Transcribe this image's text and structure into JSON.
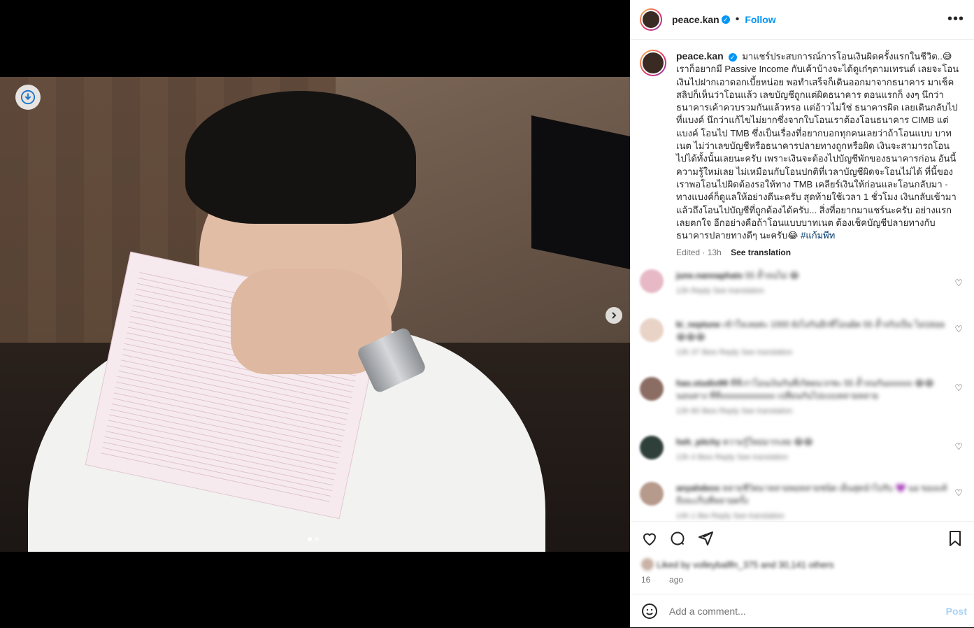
{
  "post": {
    "username": "peace.kan",
    "follow_label": "Follow",
    "more_label": "•••",
    "caption": "มาแชร์ประสบการณ์การโอนเงินผิดครั้งแรกในชีวิต..😅 เราก็อยากมี Passive Income กับเค้าบ้างจะได้ดูเก๋ๆตามเทรนด์ เลยจะโอนเงินไปฝากเอาดอกเบี้ยหน่อย พอทำเสร็จก็เดินออกมาจากธนาคาร มาเช็คสลิปก็เห็นว่าโอนแล้ว เลขบัญชีถูกแต่ผิดธนาคาร ตอนแรกก็ งงๆ นึกว่าธนาคารเค้าควบรวมกันแล้วหรอ แต่อ้าวไม่ใช่ ธนาคารผิด เลยเดินกลับไปที่แบงค์ นึกว่าแก้ไขไม่ยากซึ่งจากใบโอนเราต้องโอนธนาคาร CIMB แต่แบงค์ โอนไป TMB ซึ่งเป็นเรื่องที่อยากบอกทุกคนเลยว่าถ้าโอนแบบ บาทเนต ไม่ว่าเลขบัญชีหรือธนาคารปลายทางถูกหรือผิด เงินจะสามารถโอนไปได้ทั้งนั้นเลยนะครับ เพราะเงินจะต้องไปบัญชีพักของธนาคารก่อน อันนี้ความรู้ใหม่เลย ไม่เหมือนกับโอนปกติที่เวลาบัญชีผิดจะโอนไม่ได้ ที่นี้ของเราพอโอนไปผิดต้องรอให้ทาง TMB เคลียร์เงินให้ก่อนและโอนกลับมา - ทางแบงค์ก็ดูแลให้อย่างดีนะครับ สุดท้ายใช้เวลา 1 ชั่วโมง เงินกลับเข้ามาแล้วถึงโอนไปบัญชีที่ถูกต้องได้ครับ... สิ่งที่อยากมาแชร์นะครับ อย่างแรกเลยตกใจ อีกอย่างคือถ้าโอนแบบบาทเนต ต้องเช็คบัญชีปลายทางกับธนาคารปลายทางดีๆ นะครับ😂",
    "hashtag": "#แก้มพีท",
    "edited": "Edited · 13h",
    "see_translation": "See translation",
    "add_comment_placeholder": "Add a comment...",
    "post_label": "Post",
    "time_ago_prefix": "16",
    "time_ago_suffix": "ago",
    "likes_text": "Liked by volleyballfn_375 and 30,141 others"
  },
  "comments": [
    {
      "user": "june.nannaphats",
      "text": "55 ล้ำจนไม่ 😂",
      "meta": "13h   Reply   See translation",
      "avatar_color": "#e7b9c7"
    },
    {
      "user": "ki_neptune",
      "text": "เข้าใจเลยค่ะ 1000 ยังไงกันอีกที่โอนผิด 55 ล้ำจริงเป็น ไม่ปล่อย 😂😂😂",
      "meta": "13h   37 likes   Reply   See translation",
      "avatar_color": "#e9d3c7"
    },
    {
      "user": "hao.studio99",
      "text": "ที่ที่เราโอนเงินกันที่เกิดผนวกชะ 55 ล้ำจนกันxxxxxx 😂😂 นอนหาง ที่ที่xxxxxxxxxxxxx เปลี่ยนกันไปแบบหลายหลาย",
      "meta": "13h   80 likes   Reply   See translation",
      "avatar_color": "#8c6d63"
    },
    {
      "user": "heh_pitchy",
      "text": "ความรู้ใหม่มากเลย 😂😂",
      "meta": "13h   4 likes   Reply   See translation",
      "avatar_color": "#2f3f3a"
    },
    {
      "user": "anyahdeox",
      "text": "หลายชีวิตมาหลายพอหลายชนิด เย็นสุดนำไปรับ 💜 นอ ของแท้ถึงจะเก็บที่หลายครั้ง",
      "meta": "14h   1 like   Reply   See translation",
      "avatar_color": "#b69a8c"
    }
  ],
  "icons": {
    "download": "download-icon",
    "next": "chevron-right-icon",
    "like": "heart-icon",
    "comment": "comment-icon",
    "share": "share-icon",
    "save": "bookmark-icon",
    "emoji": "emoji-icon",
    "verified": "verified-icon"
  },
  "carousel": {
    "count": 2,
    "active": 0
  },
  "colors": {
    "accent": "#0095f6",
    "text": "#262626",
    "muted": "#737373"
  }
}
